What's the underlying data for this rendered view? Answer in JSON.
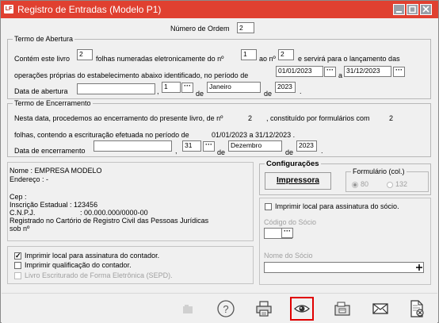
{
  "window": {
    "title": "Registro de Entradas (Modelo P1)",
    "icon_text": "LF",
    "accent_color": "#e04030"
  },
  "ordem": {
    "label": "Número de Ordem",
    "value": "2"
  },
  "abertura": {
    "legend": "Termo de Abertura",
    "line1_a": "Contém este livro",
    "folhas_value": "2",
    "line1_b": "folhas numeradas eletronicamente do nº",
    "from_value": "1",
    "line1_c": "ao nº",
    "to_value": "2",
    "line1_d": "e servirá para o lançamento das",
    "line2": "operações próprias do estabelecimento abaixo identificado, no período de",
    "date_start": "01/01/2023",
    "a_label": "a",
    "date_end": "31/12/2023",
    "data_label": "Data de abertura",
    "city_value": "",
    "comma": ",",
    "day_value": "1",
    "de1": "de",
    "month_value": "Janeiro",
    "de2": "de",
    "year_value": "2023",
    "period": "."
  },
  "encerramento": {
    "legend": "Termo de Encerramento",
    "line1_a": "Nesta data, procedemos ao encerramento do presente livro, de nº",
    "livro_num": "2",
    "line1_b": ", constituído por formulários com",
    "form_count": "2",
    "line2_a": "folhas, contendo a escrituração efetuada no período de",
    "line2_b": "01/01/2023  a 31/12/2023 .",
    "data_label": "Data de encerramento",
    "city_value": "",
    "comma": ",",
    "day_value": "31",
    "de1": "de",
    "month_value": "Dezembro",
    "de2": "de",
    "year_value": "2023",
    "period": "."
  },
  "company": {
    "nome": "Nome      : EMPRESA MODELO",
    "endereco": "Endereço : -",
    "cep": "Cep        :",
    "inscricao": "Inscrição Estadual : 123456",
    "cnpj_label": "C.N.P.J.",
    "cnpj_value": ": 00.000.000/0000-00",
    "registrado": "Registrado no Cartório de Registro Civil das Pessoas Jurídicas",
    "sob": "sob nº"
  },
  "config": {
    "legend": "Configurações",
    "impressora_label": "Impressora",
    "formulario_legend": "Formulário (col.)",
    "opt80": "80",
    "opt132": "132"
  },
  "options": {
    "contador_local": "Imprimir local para assinatura do contador.",
    "contador_qual": "Imprimir qualificação do contador.",
    "livro_sepd": "Livro Escriturado de Forma Eletrônica (SEPD).",
    "socio_local": "Imprimir local para assinatura do sócio.",
    "codigo_socio": "Código do Sócio",
    "nome_socio": "Nome do Sócio",
    "check_mark": "✓"
  },
  "toolbar": {
    "help_glyph": "?"
  }
}
